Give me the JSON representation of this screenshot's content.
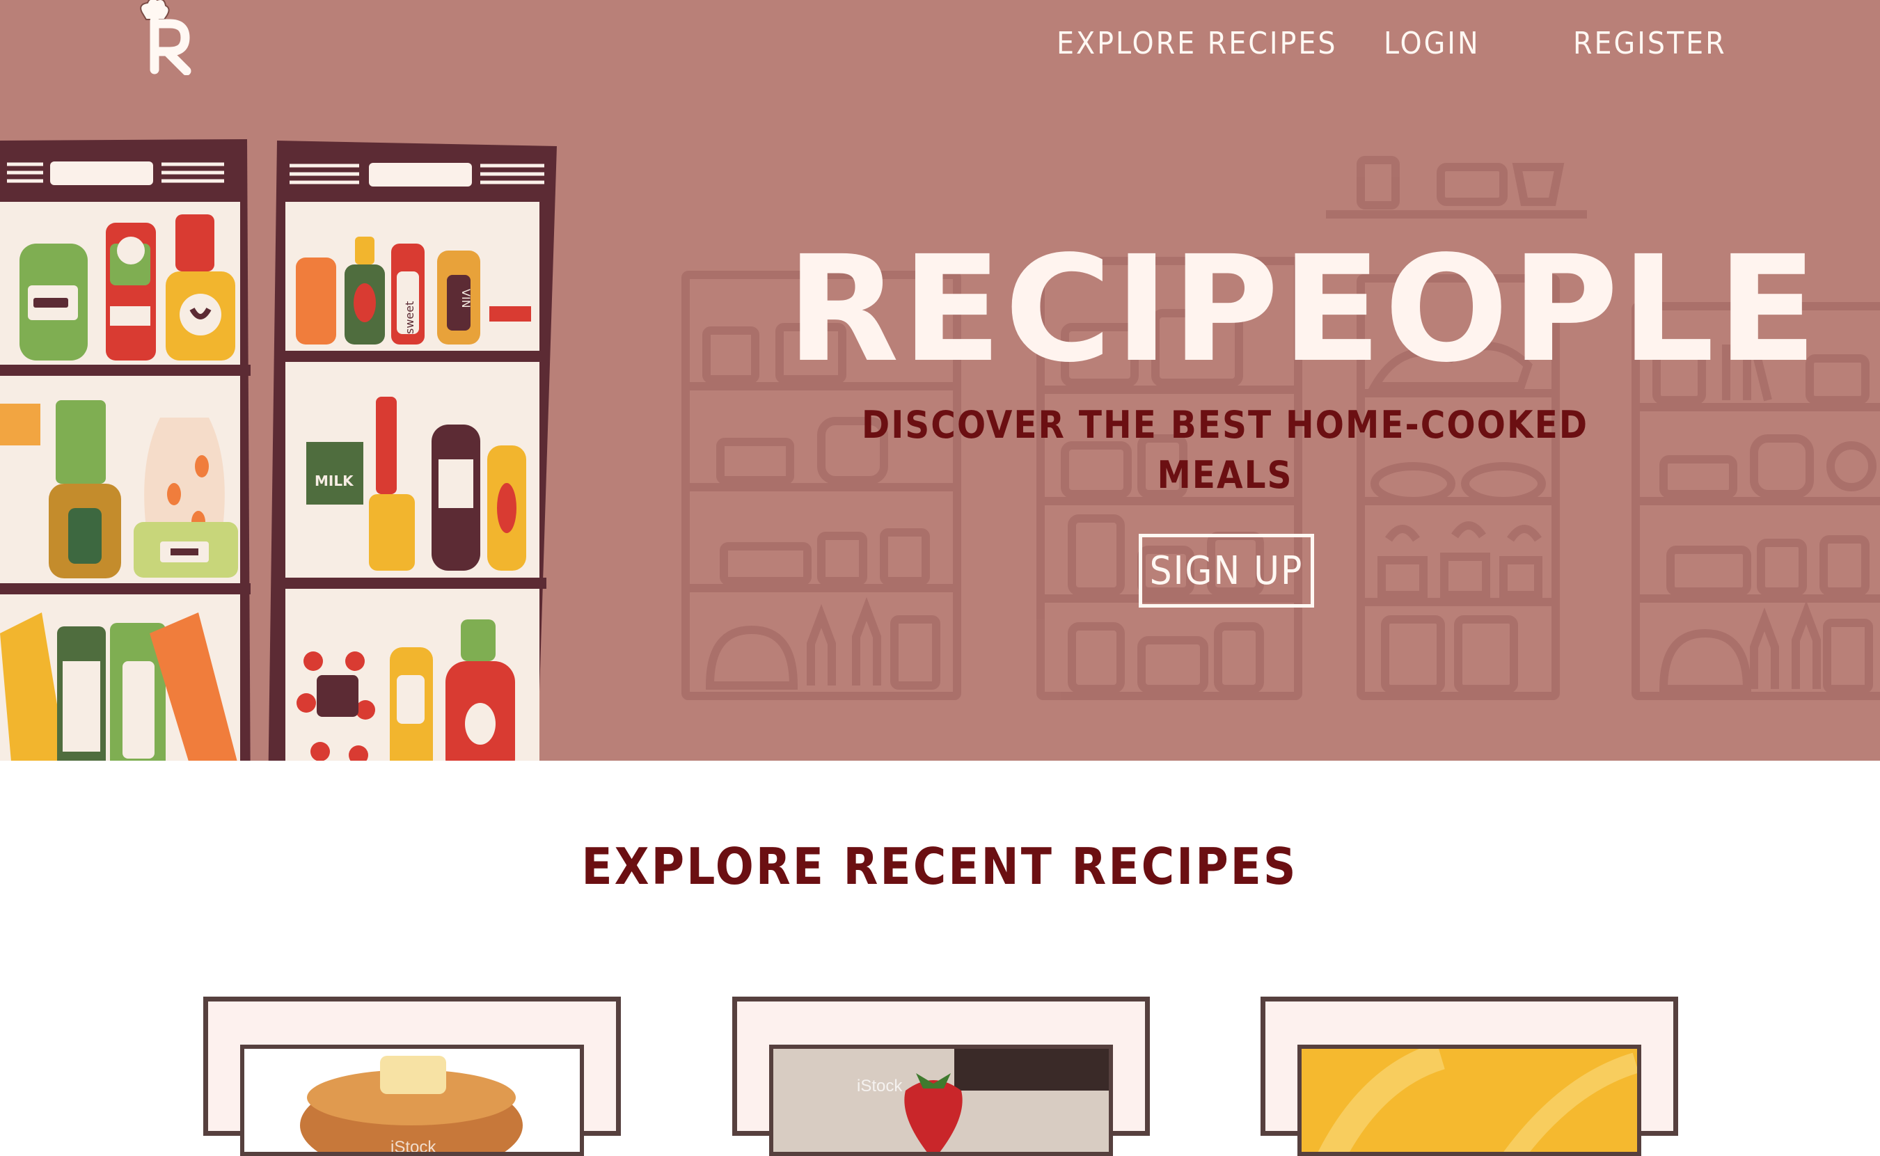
{
  "nav": {
    "links": [
      "EXPLORE RECIPES",
      "LOGIN",
      "REGISTER"
    ]
  },
  "hero": {
    "title": "RECIPEOPLE",
    "subtitle": "DISCOVER THE BEST HOME-COOKED MEALS",
    "signup_label": "SIGN UP"
  },
  "shelf_labels": {
    "milk": "MILK",
    "sweet": "sweet",
    "vin": "VIN"
  },
  "section": {
    "title": "EXPLORE RECENT RECIPES"
  },
  "cards": [
    {
      "image": "pancakes",
      "watermark": "iStock"
    },
    {
      "image": "strawberry",
      "watermark": "iStock"
    },
    {
      "image": "yellow-dish",
      "watermark": ""
    }
  ],
  "colors": {
    "hero_bg": "#b98078",
    "accent_dark": "#6b0f12",
    "cream": "#fff4ef",
    "card_border": "#56403e"
  }
}
